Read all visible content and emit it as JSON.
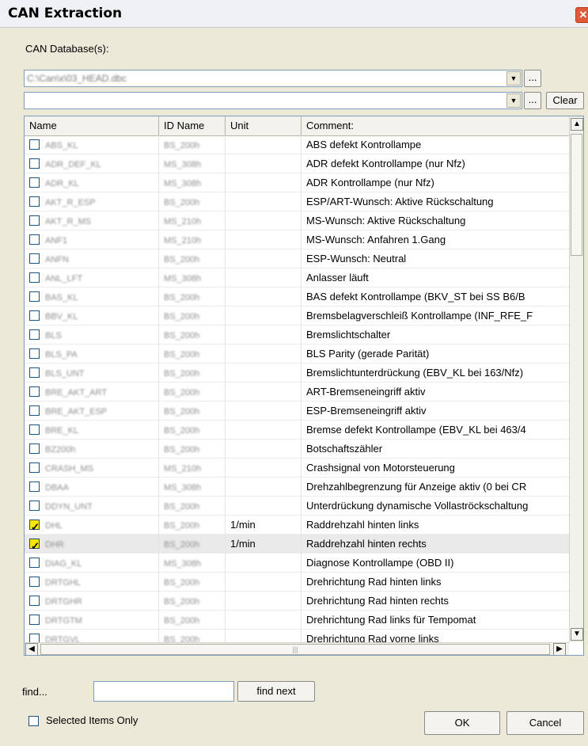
{
  "window": {
    "title": "CAN Extraction",
    "close_symbol": "✕"
  },
  "database_label": "CAN Database(s):",
  "combo1": {
    "value": "C:\\Can\\x\\03_HEAD.dbc",
    "browse_label": "..."
  },
  "combo2": {
    "value": "",
    "browse_label": "...",
    "clear_label": "Clear"
  },
  "columns": {
    "name": "Name",
    "id_name": "ID Name",
    "unit": "Unit",
    "comment": "Comment:"
  },
  "rows": [
    {
      "name": "ABS_KL",
      "id": "BS_200h",
      "unit": "",
      "comment": "ABS defekt Kontrollampe",
      "checked": false
    },
    {
      "name": "ADR_DEF_KL",
      "id": "MS_308h",
      "unit": "",
      "comment": "ADR defekt Kontrollampe (nur Nfz)",
      "checked": false
    },
    {
      "name": "ADR_KL",
      "id": "MS_308h",
      "unit": "",
      "comment": "ADR Kontrollampe (nur Nfz)",
      "checked": false
    },
    {
      "name": "AKT_R_ESP",
      "id": "BS_200h",
      "unit": "",
      "comment": "ESP/ART-Wunsch: Aktive Rückschaltung",
      "checked": false
    },
    {
      "name": "AKT_R_MS",
      "id": "MS_210h",
      "unit": "",
      "comment": "MS-Wunsch: Aktive Rückschaltung",
      "checked": false
    },
    {
      "name": "ANF1",
      "id": "MS_210h",
      "unit": "",
      "comment": "MS-Wunsch: Anfahren 1.Gang",
      "checked": false
    },
    {
      "name": "ANFN",
      "id": "BS_200h",
      "unit": "",
      "comment": "ESP-Wunsch: Neutral",
      "checked": false
    },
    {
      "name": "ANL_LFT",
      "id": "MS_308h",
      "unit": "",
      "comment": "Anlasser läuft",
      "checked": false
    },
    {
      "name": "BAS_KL",
      "id": "BS_200h",
      "unit": "",
      "comment": "BAS defekt Kontrollampe (BKV_ST bei SS B6/B",
      "checked": false
    },
    {
      "name": "BBV_KL",
      "id": "BS_200h",
      "unit": "",
      "comment": "Bremsbelagverschleiß Kontrollampe (INF_RFE_F",
      "checked": false
    },
    {
      "name": "BLS",
      "id": "BS_200h",
      "unit": "",
      "comment": "Bremslichtschalter",
      "checked": false
    },
    {
      "name": "BLS_PA",
      "id": "BS_200h",
      "unit": "",
      "comment": "BLS Parity (gerade Parität)",
      "checked": false
    },
    {
      "name": "BLS_UNT",
      "id": "BS_200h",
      "unit": "",
      "comment": "Bremslichtunterdrückung (EBV_KL bei 163/Nfz)",
      "checked": false
    },
    {
      "name": "BRE_AKT_ART",
      "id": "BS_200h",
      "unit": "",
      "comment": "ART-Bremseneingriff aktiv",
      "checked": false
    },
    {
      "name": "BRE_AKT_ESP",
      "id": "BS_200h",
      "unit": "",
      "comment": "ESP-Bremseneingriff aktiv",
      "checked": false
    },
    {
      "name": "BRE_KL",
      "id": "BS_200h",
      "unit": "",
      "comment": "Bremse defekt Kontrollampe (EBV_KL bei 463/4",
      "checked": false
    },
    {
      "name": "BZ200h",
      "id": "BS_200h",
      "unit": "",
      "comment": "Botschaftszähler",
      "checked": false
    },
    {
      "name": "CRASH_MS",
      "id": "MS_210h",
      "unit": "",
      "comment": "Crashsignal von Motorsteuerung",
      "checked": false
    },
    {
      "name": "DBAA",
      "id": "MS_308h",
      "unit": "",
      "comment": "Drehzahlbegrenzung für Anzeige aktiv (0 bei CR",
      "checked": false
    },
    {
      "name": "DDYN_UNT",
      "id": "BS_200h",
      "unit": "",
      "comment": "Unterdrückung dynamische Vollaströckschaltung",
      "checked": false
    },
    {
      "name": "DHL",
      "id": "BS_200h",
      "unit": "1/min",
      "comment": "Raddrehzahl hinten links",
      "checked": true
    },
    {
      "name": "DHR",
      "id": "BS_200h",
      "unit": "1/min",
      "comment": "Raddrehzahl hinten rechts",
      "checked": true
    },
    {
      "name": "DIAG_KL",
      "id": "MS_308h",
      "unit": "",
      "comment": "Diagnose Kontrollampe (OBD II)",
      "checked": false
    },
    {
      "name": "DRTGHL",
      "id": "BS_200h",
      "unit": "",
      "comment": "Drehrichtung Rad hinten links",
      "checked": false
    },
    {
      "name": "DRTGHR",
      "id": "BS_200h",
      "unit": "",
      "comment": "Drehrichtung Rad hinten rechts",
      "checked": false
    },
    {
      "name": "DRTGTM",
      "id": "BS_200h",
      "unit": "",
      "comment": "Drehrichtung Rad links für Tempomat",
      "checked": false
    },
    {
      "name": "DRTGVL",
      "id": "BS_200h",
      "unit": "",
      "comment": "Drehrichtung Rad vorne links",
      "checked": false
    }
  ],
  "find": {
    "label": "find...",
    "value": "",
    "find_next_label": "find next"
  },
  "selected_only_label": "Selected Items Only",
  "ok_label": "OK",
  "cancel_label": "Cancel"
}
